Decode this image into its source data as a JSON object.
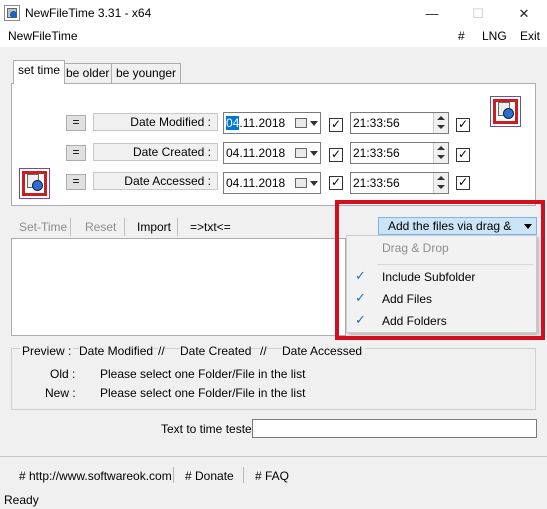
{
  "window": {
    "title": "NewFileTime 3.31 - x64",
    "controls": {
      "minimize": "—",
      "maximize": "☐",
      "close": "✕"
    }
  },
  "menubar": {
    "app_label": "NewFileTime",
    "right_items": [
      "#",
      "LNG",
      "Exit"
    ]
  },
  "tabs": [
    "set time",
    "be older",
    "be younger"
  ],
  "active_tab": "set time",
  "rows": [
    {
      "eq": "=",
      "label": "Date Modified :",
      "date_sel": "04",
      "date_rest": ".11.2018",
      "time": "21:33:56",
      "date_checked": true,
      "time_checked": true
    },
    {
      "eq": "=",
      "label": "Date Created :",
      "date_sel": "",
      "date_rest": "04.11.2018",
      "time": "21:33:56",
      "date_checked": true,
      "time_checked": true
    },
    {
      "eq": "=",
      "label": "Date Accessed :",
      "date_sel": "",
      "date_rest": "04.11.2018",
      "time": "21:33:56",
      "date_checked": true,
      "time_checked": true
    }
  ],
  "check_mark": "✓",
  "toolbar": {
    "set_time": "Set-Time",
    "reset": "Reset",
    "import": "Import",
    "txt": "=>txt<=",
    "add_button": "Add the files via drag & drop"
  },
  "dropdown": {
    "header": "Drag & Drop",
    "items": [
      {
        "label": "Include Subfolder",
        "checked": true
      },
      {
        "label": "Add Files",
        "checked": true
      },
      {
        "label": "Add Folders",
        "checked": true
      }
    ]
  },
  "preview": {
    "label": "Preview  :",
    "columns": [
      "Date Modified",
      "//",
      "Date Created",
      "//",
      "Date Accessed"
    ],
    "old_label": "Old :",
    "new_label": "New :",
    "old_text": "Please select one Folder/File in the list",
    "new_text": "Please select one Folder/File in the list"
  },
  "tester": {
    "label": "Text to time tester",
    "value": ""
  },
  "links": [
    "# http://www.softwareok.com",
    "# Donate",
    "# FAQ"
  ],
  "status": "Ready",
  "colors": {
    "highlight_box": "#d10f1f",
    "selection": "#0078d7",
    "add_button_bg": "#cce4f7"
  }
}
